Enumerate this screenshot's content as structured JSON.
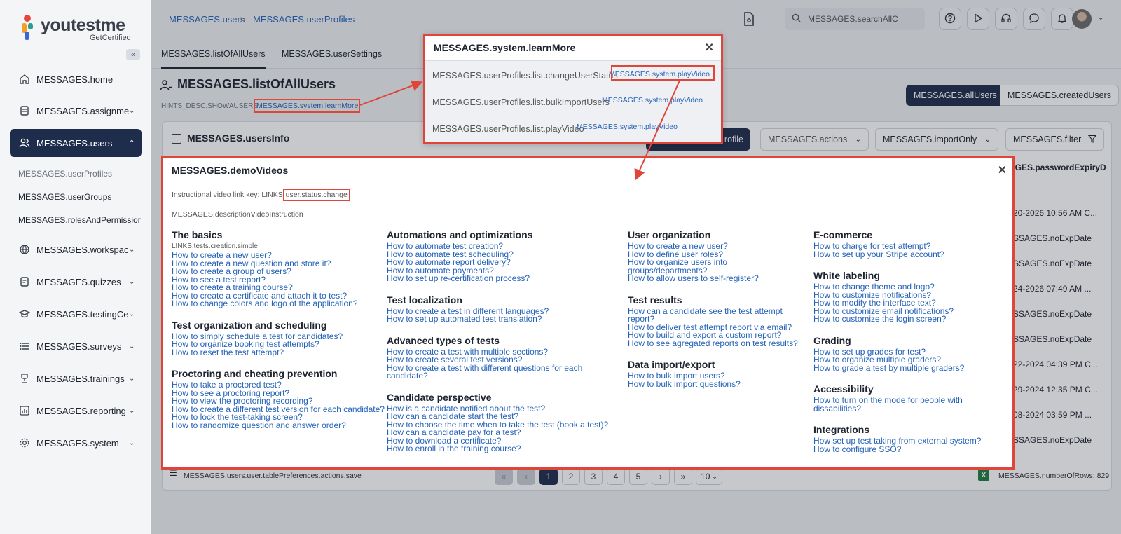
{
  "logo": {
    "brand": "youtestme",
    "sub": "GetCertified"
  },
  "sidebar": {
    "collapse": "«",
    "items": [
      {
        "label": "MESSAGES.home",
        "icon": "home-icon"
      },
      {
        "label": "MESSAGES.assignmer",
        "icon": "document-icon"
      },
      {
        "label": "MESSAGES.users",
        "icon": "users-icon"
      },
      {
        "label": "MESSAGES.workspac",
        "icon": "globe-icon"
      },
      {
        "label": "MESSAGES.quizzes",
        "icon": "quiz-icon"
      },
      {
        "label": "MESSAGES.testingCer",
        "icon": "graduation-icon"
      },
      {
        "label": "MESSAGES.surveys",
        "icon": "list-icon"
      },
      {
        "label": "MESSAGES.trainings",
        "icon": "trophy-icon"
      },
      {
        "label": "MESSAGES.reporting",
        "icon": "chart-icon"
      },
      {
        "label": "MESSAGES.system",
        "icon": "gear-icon"
      }
    ],
    "sub_items": [
      "MESSAGES.userProfiles",
      "MESSAGES.userGroups",
      "MESSAGES.rolesAndPermissior"
    ]
  },
  "breadcrumb": {
    "first": "MESSAGES.users",
    "sep": ">",
    "second": "MESSAGES.userProfiles"
  },
  "search": {
    "placeholder": "MESSAGES.searchAllC"
  },
  "tabs": [
    "MESSAGES.listOfAllUsers",
    "MESSAGES.userSettings"
  ],
  "page": {
    "title": "MESSAGES.listOfAllUsers",
    "hint": "HINTS_DESC.SHOWAUSERS",
    "learn_more": "MESSAGES.system.learnMore",
    "filter_all": "MESSAGES.allUsers",
    "filter_created": "MESSAGES.createdUsers"
  },
  "card": {
    "title": "MESSAGES.usersInfo",
    "new_profile": "rofile",
    "actions": "MESSAGES.actions",
    "import_only": "MESSAGES.importOnly",
    "filter": "MESSAGES.filter",
    "column_header": "AGES.passwordExpiryD",
    "row_values": [
      "20-2026 10:56 AM C...",
      "SSAGES.noExpDate",
      "SSAGES.noExpDate",
      "24-2026 07:49 AM ...",
      "SSAGES.noExpDate",
      "SSAGES.noExpDate",
      "22-2024 04:39 PM C...",
      "29-2024 12:35 PM C...",
      "08-2024 03:59 PM ...",
      "SSAGES.noExpDate"
    ]
  },
  "footer": {
    "save_prefs": "MESSAGES.users.user.tablePreferences.actions.save",
    "first": "«",
    "prev": "‹",
    "pages": [
      "1",
      "2",
      "3",
      "4",
      "5"
    ],
    "next": "›",
    "last": "»",
    "page_size": "10",
    "rows": "MESSAGES.numberOfRows: 829"
  },
  "learn_popup": {
    "title": "MESSAGES.system.learnMore",
    "rows": [
      {
        "text": "MESSAGES.userProfiles.list.changeUserStatus",
        "link": "MESSAGES.system.playVideo"
      },
      {
        "text": "MESSAGES.userProfiles.list.bulkImportUsers",
        "link": "MESSAGES.system.playVideo"
      },
      {
        "text": "MESSAGES.userProfiles.list.playVideo",
        "link": "MESSAGES.system.playVideo"
      }
    ]
  },
  "videos": {
    "title": "MESSAGES.demoVideos",
    "key_prefix": "Instructional video link key: LINKS.",
    "key_value": "user.status.change",
    "description": "MESSAGES.descriptionVideoInstruction",
    "columns": [
      [
        {
          "title": "The basics",
          "note": "LINKS.tests.creation.simple",
          "links": [
            "How to create a new user?",
            "How to create a new question and store it?",
            "How to create a group of users?",
            "How to see a test report?",
            "How to create a training course?",
            "How to create a certificate and attach it to test?",
            "How to change colors and logo of the application?"
          ]
        },
        {
          "title": "Test organization and scheduling",
          "links": [
            "How to simply schedule a test for candidates?",
            "How to organize booking test attempts?",
            "How to reset the test attempt?"
          ]
        },
        {
          "title": "Proctoring and cheating prevention",
          "links": [
            "How to take a proctored test?",
            "How to see a proctoring report?",
            "How to view the proctoring recording?",
            "How to create a different test version for each candidate?",
            "How to lock the test-taking screen?",
            "How to randomize question and answer order?"
          ]
        }
      ],
      [
        {
          "title": "Automations and optimizations",
          "links": [
            "How to automate test creation?",
            "How to automate test scheduling?",
            "How to automate report delivery?",
            "How to automate payments?",
            "How to set up re-certification process?"
          ]
        },
        {
          "title": "Test localization",
          "links": [
            "How to create a test in different languages?",
            "How to set up automated test translation?"
          ]
        },
        {
          "title": "Advanced types of tests",
          "links": [
            "How to create a test with multiple sections?",
            "How to create several test versions?",
            "How to create a test with different questions for each candidate?"
          ]
        },
        {
          "title": "Candidate perspective",
          "links": [
            "How is a candidate notified about the test?",
            "How can a candidate start the test?",
            "How to choose the time when to take the test (book a test)?",
            "How can a candidate pay for a test?",
            "How to download a certificate?",
            "How to enroll in the training course?"
          ]
        }
      ],
      [
        {
          "title": "User organization",
          "links": [
            "How to create a new user?",
            "How to define user roles?",
            "How to organize users into groups/departments?",
            "How to allow users to self-register?"
          ]
        },
        {
          "title": "Test results",
          "links": [
            "How can a candidate see the test attempt report?",
            "How to deliver test attempt report via email?",
            "How to build and export a custom report?",
            "How to see agregated reports on test results?"
          ]
        },
        {
          "title": "Data import/export",
          "links": [
            "How to bulk import users?",
            "How to bulk import questions?"
          ]
        }
      ],
      [
        {
          "title": "E-commerce",
          "links": [
            "How to charge for test attempt?",
            "How to set up your Stripe account?"
          ]
        },
        {
          "title": "White labeling",
          "links": [
            "How to change theme and logo?",
            "How to customize notifications?",
            "How to modify the interface text?",
            "How to customize email notifications?",
            "How to customize the login screen?"
          ]
        },
        {
          "title": "Grading",
          "links": [
            "How to set up grades for test?",
            "How to organize multiple graders?",
            "How to grade a test by multiple graders?"
          ]
        },
        {
          "title": "Accessibility",
          "links": [
            "How to turn on the mode for people with dissabilities?"
          ]
        },
        {
          "title": "Integrations",
          "links": [
            "How set up test taking from external system?",
            "How to configure SSO?"
          ]
        }
      ]
    ]
  },
  "colors": {
    "accent": "#1f2d4d",
    "link": "#2563b8",
    "highlight": "#e0453a"
  }
}
